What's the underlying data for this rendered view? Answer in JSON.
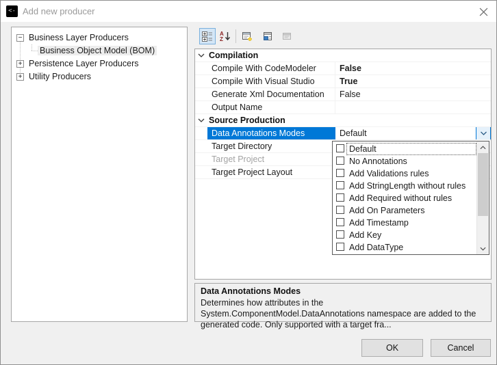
{
  "window": {
    "title": "Add new producer",
    "close_icon": "close-icon"
  },
  "tree": {
    "items": [
      {
        "label": "Business Layer Producers",
        "level": 0,
        "expander": "minus",
        "selected": false
      },
      {
        "label": "Business Object Model (BOM)",
        "level": 1,
        "expander": "none",
        "selected": true
      },
      {
        "label": "Persistence Layer Producers",
        "level": 0,
        "expander": "plus",
        "selected": false
      },
      {
        "label": "Utility Producers",
        "level": 0,
        "expander": "plus",
        "selected": false
      }
    ]
  },
  "toolbar": {
    "buttons": [
      {
        "icon": "categorized-view-icon",
        "active": true,
        "disabled": false
      },
      {
        "icon": "alphabetical-sort-icon",
        "active": false,
        "disabled": false
      },
      {
        "icon": "add-property-tab-icon",
        "active": false,
        "disabled": false
      },
      {
        "icon": "show-attached-properties-icon",
        "active": false,
        "disabled": false
      },
      {
        "icon": "property-pages-icon",
        "active": false,
        "disabled": true
      }
    ]
  },
  "property_grid": {
    "rows": [
      {
        "type": "category",
        "label": "Compilation"
      },
      {
        "type": "property",
        "name": "Compile With CodeModeler",
        "value": "False",
        "bold": true
      },
      {
        "type": "property",
        "name": "Compile With Visual Studio",
        "value": "True",
        "bold": true
      },
      {
        "type": "property",
        "name": "Generate Xml Documentation",
        "value": "False",
        "bold": false
      },
      {
        "type": "property",
        "name": "Output Name",
        "value": "",
        "bold": false
      },
      {
        "type": "category",
        "label": "Source Production"
      },
      {
        "type": "property",
        "name": "Data Annotations Modes",
        "value": "Default",
        "bold": false,
        "selected": true,
        "editor": "dropdown"
      },
      {
        "type": "property",
        "name": "Target Directory",
        "value": "",
        "bold": false
      },
      {
        "type": "property",
        "name": "Target Project",
        "value": "",
        "bold": false,
        "disabled": true
      },
      {
        "type": "property",
        "name": "Target Project Layout",
        "value": "",
        "bold": false
      }
    ]
  },
  "dropdown": {
    "items": [
      {
        "label": "Default",
        "checked": false,
        "focused": true
      },
      {
        "label": "No Annotations",
        "checked": false
      },
      {
        "label": "Add Validations rules",
        "checked": false
      },
      {
        "label": "Add StringLength without rules",
        "checked": false
      },
      {
        "label": "Add Required without rules",
        "checked": false
      },
      {
        "label": "Add On Parameters",
        "checked": false
      },
      {
        "label": "Add Timestamp",
        "checked": false
      },
      {
        "label": "Add Key",
        "checked": false
      },
      {
        "label": "Add DataType",
        "checked": false
      }
    ]
  },
  "help": {
    "title": "Data Annotations Modes",
    "text": "Determines how attributes in the System.ComponentModel.DataAnnotations namespace are added to the generated code. Only supported with a target fra..."
  },
  "footer": {
    "ok_label": "OK",
    "cancel_label": "Cancel"
  },
  "colors": {
    "selection_blue": "#0078d7",
    "dialog_background": "#f0f0f0",
    "titlebar_background": "#ffffff",
    "selected_tree_item": "#ededed",
    "button_background": "#e1e1e1"
  }
}
